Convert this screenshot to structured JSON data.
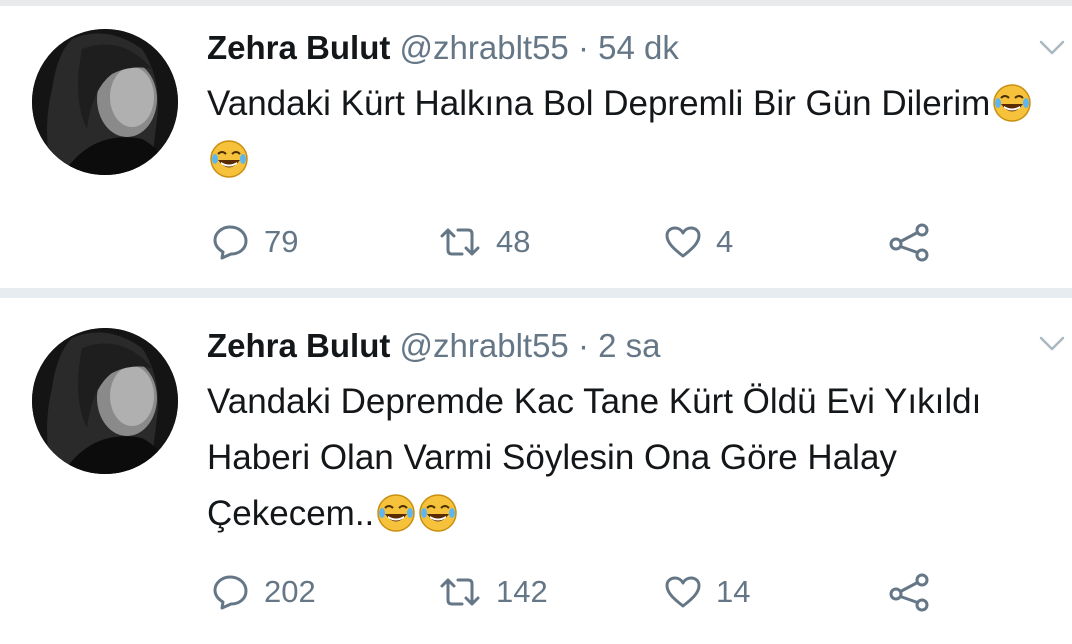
{
  "tweets": [
    {
      "author_name": "Zehra Bulut",
      "handle": "@zhrablt55",
      "separator": "·",
      "time": "54 dk",
      "text": "Vandaki Kürt Halkına Bol Depremli Bir Gün Dilerim",
      "emojis": [
        "face-with-tears-of-joy-emoji",
        "face-with-tears-of-joy-emoji"
      ],
      "replies": "79",
      "retweets": "48",
      "likes": "4"
    },
    {
      "author_name": "Zehra Bulut",
      "handle": "@zhrablt55",
      "separator": "·",
      "time": "2 sa",
      "text": "Vandaki Depremde Kac Tane Kürt Öldü Evi Yıkıldı Haberi Olan Varmi Söylesin Ona Göre Halay Çekecem..",
      "emojis": [
        "face-with-tears-of-joy-emoji",
        "face-with-tears-of-joy-emoji"
      ],
      "replies": "202",
      "retweets": "142",
      "likes": "14"
    }
  ],
  "icons": {
    "reply": "reply-icon",
    "retweet": "retweet-icon",
    "like": "heart-icon",
    "share": "share-icon",
    "menu": "chevron-down-icon"
  },
  "colors": {
    "text": "#14171a",
    "secondary": "#657786",
    "divider": "#e6ecf0",
    "emoji_face": "#f7c23b"
  }
}
